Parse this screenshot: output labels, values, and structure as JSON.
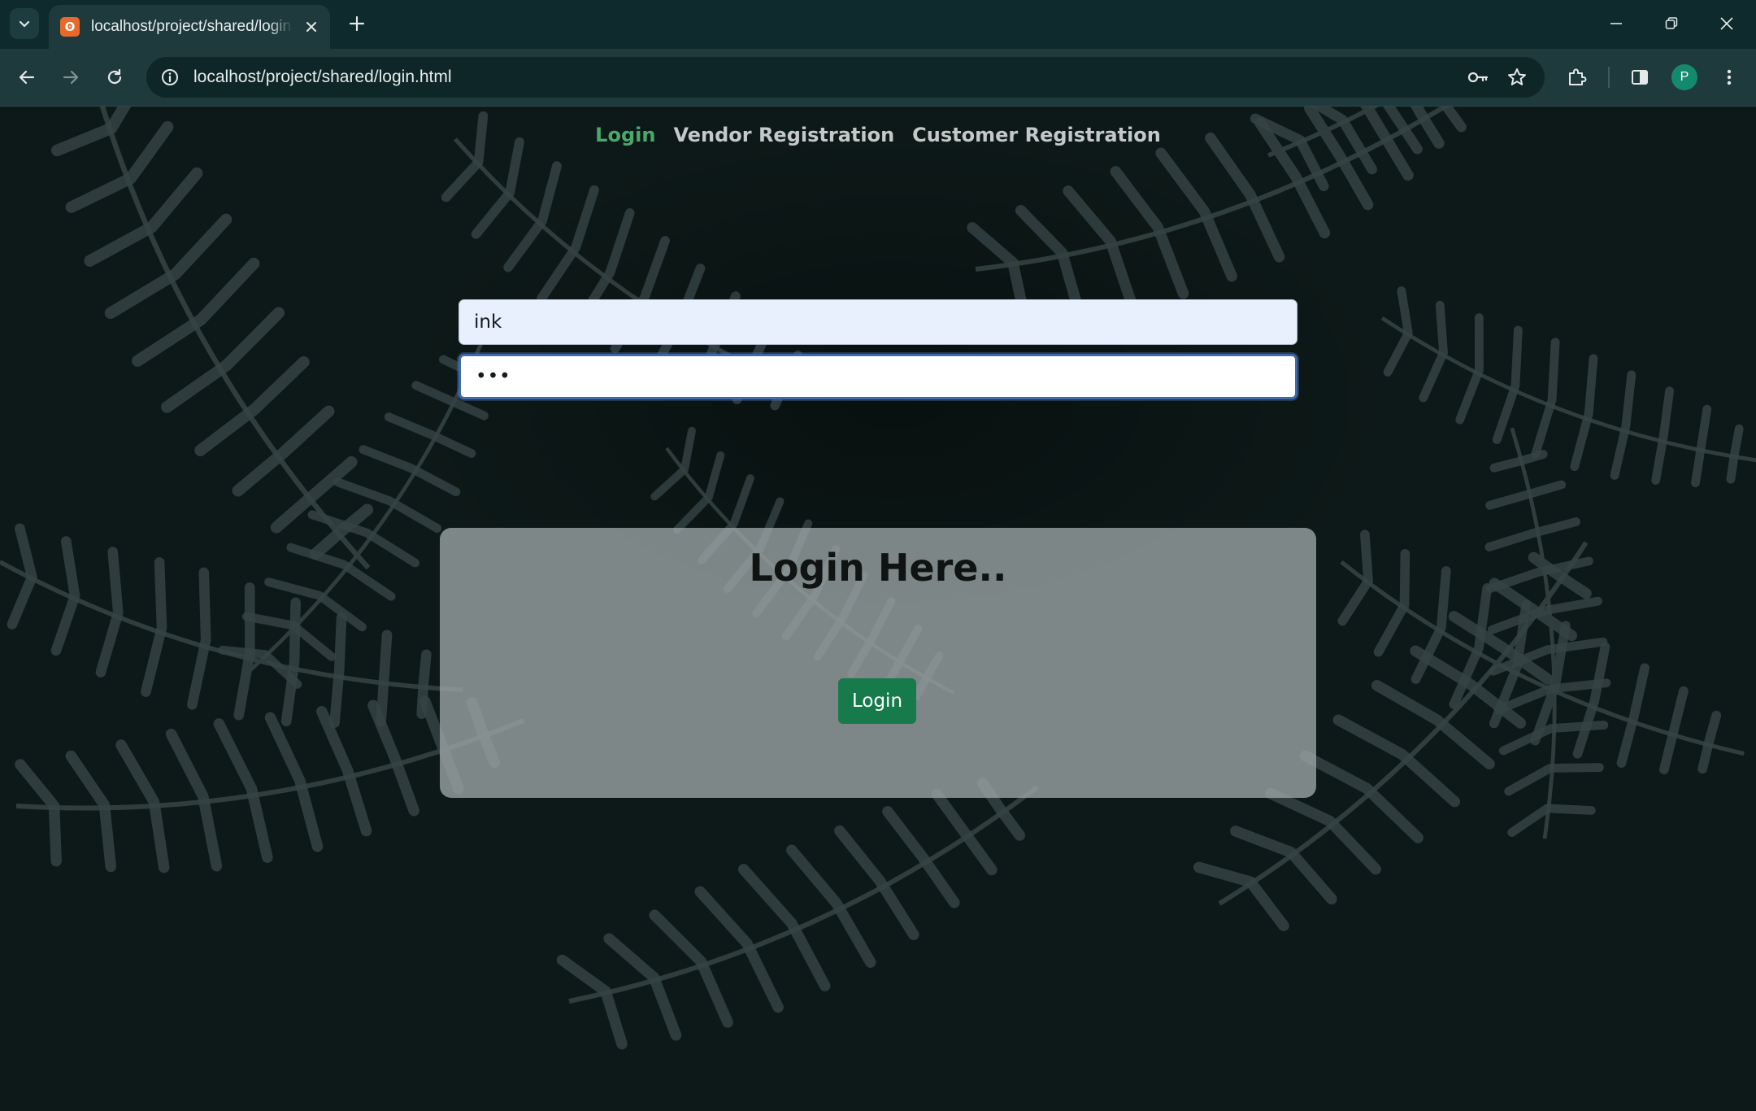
{
  "browser": {
    "tab_title": "localhost/project/shared/login.html",
    "url": "localhost/project/shared/login.html",
    "profile_initial": "P"
  },
  "nav": {
    "items": [
      {
        "label": "Login",
        "active": true
      },
      {
        "label": "Vendor Registration",
        "active": false
      },
      {
        "label": "Customer Registration",
        "active": false
      }
    ]
  },
  "login_form": {
    "heading": "Login Here..",
    "username_value": "ink",
    "password_value": "•••",
    "submit_label": "Login"
  },
  "colors": {
    "active_nav": "#4ca86a",
    "button": "#177a4b",
    "focus_border": "#3f69a8"
  }
}
